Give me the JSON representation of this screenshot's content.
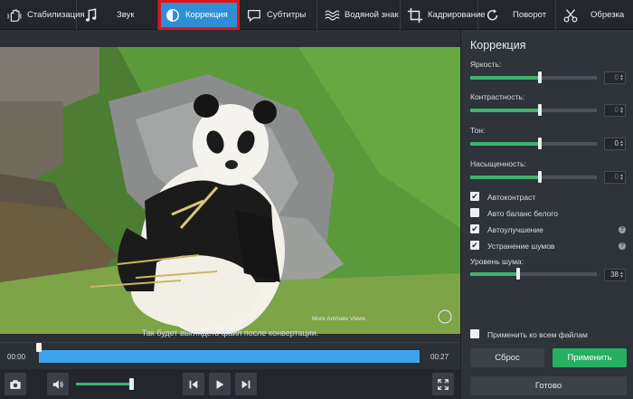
{
  "toolbar": {
    "tabs": [
      {
        "label": "Стабилизация",
        "icon": "hand-stabilize-icon"
      },
      {
        "label": "Звук",
        "icon": "music-note-icon"
      },
      {
        "label": "Коррекция",
        "icon": "contrast-icon",
        "active": true
      },
      {
        "label": "Субтитры",
        "icon": "speech-bubble-icon"
      },
      {
        "label": "Водяной знак",
        "icon": "watermark-icon"
      },
      {
        "label": "Кадрирование",
        "icon": "crop-icon"
      },
      {
        "label": "Поворот",
        "icon": "rotate-icon"
      },
      {
        "label": "Обрезка",
        "icon": "scissors-icon"
      }
    ]
  },
  "video": {
    "watermark_text": "More Animate Views",
    "caption": "Так будет выглядеть файл после конвертации."
  },
  "timeline": {
    "start": "00:00",
    "end": "00:27",
    "progress": 0
  },
  "controls": {
    "volume": 1.0
  },
  "panel": {
    "title": "Коррекция",
    "sliders": [
      {
        "label": "Яркость:",
        "value": "0",
        "level": 0.5,
        "dim": true
      },
      {
        "label": "Контрастность:",
        "value": "0",
        "level": 0.5,
        "dim": true
      },
      {
        "label": "Тон:",
        "value": "0",
        "level": 0.5,
        "dim": false
      },
      {
        "label": "Насыщенность:",
        "value": "0",
        "level": 0.5,
        "dim": true
      }
    ],
    "checkboxes": [
      {
        "label": "Автоконтраст",
        "checked": true,
        "help": false
      },
      {
        "label": "Авто баланс белого",
        "checked": false,
        "help": false
      },
      {
        "label": "Автоулучшение",
        "checked": true,
        "help": true
      },
      {
        "label": "Устранение шумов",
        "checked": true,
        "help": true
      }
    ],
    "noise": {
      "label": "Уровень шума:",
      "value": "38",
      "level": 0.38
    },
    "apply_all": "Применить ко всем файлам",
    "reset": "Сброс",
    "apply": "Применить",
    "done": "Готово"
  },
  "colors": {
    "accent_blue": "#2f8fd6",
    "highlight_red": "#e0141b",
    "green": "#3cb371",
    "apply_green": "#27ae60"
  }
}
